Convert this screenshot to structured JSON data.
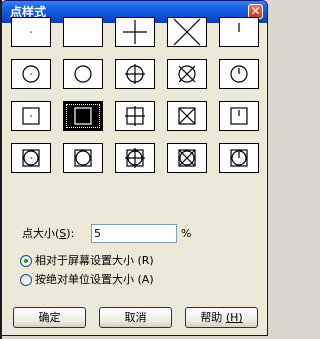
{
  "dialog": {
    "title": "点样式"
  },
  "point_styles": [
    [
      "dot",
      "none",
      "plus",
      "cross",
      "tick"
    ],
    [
      "circle-dot",
      "circle",
      "circle-plus",
      "circle-cross",
      "circle-tick"
    ],
    [
      "square-dot",
      "square",
      "square-plus",
      "square-cross",
      "square-tick"
    ],
    [
      "square-circle-dot",
      "square-circle",
      "square-circle-plus",
      "square-circle-cross",
      "square-circle-tick"
    ]
  ],
  "selected_style": "square",
  "point_size": {
    "label": "点大小",
    "mnemonic_open": "(",
    "mnemonic": "S",
    "mnemonic_close": "):",
    "value": "5",
    "unit": "%"
  },
  "size_mode": {
    "relative": {
      "label": "相对于屏幕设置大小",
      "mnemonic": "(R)",
      "checked": true
    },
    "absolute": {
      "label": "按绝对单位设置大小",
      "mnemonic": "(A)",
      "checked": false
    }
  },
  "buttons": {
    "ok": "确定",
    "cancel": "取消",
    "help": "帮助",
    "help_mnemonic": "(H)"
  },
  "icons": {
    "close": "close-icon"
  }
}
